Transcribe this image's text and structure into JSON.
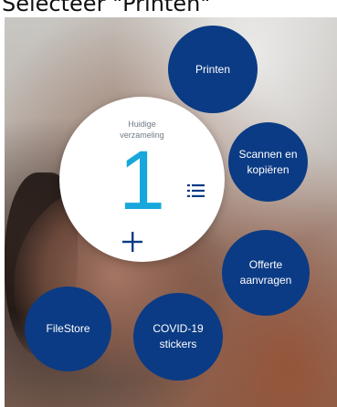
{
  "header": {
    "text": "Selecteer \"Printen\""
  },
  "collection": {
    "label": "Huidige\nverzameling",
    "count": "1"
  },
  "bubbles": {
    "printen": "Printen",
    "scannen": "Scannen en\nkopiëren",
    "offerte": "Offerte\naanvragen",
    "covid": "COVID-19\nstickers",
    "filestore": "FileStore"
  },
  "icons": {
    "list": "list-icon",
    "add": "plus-icon"
  },
  "colors": {
    "bubble": "#0b3b84",
    "count": "#18a7dc",
    "text_white": "#ffffff"
  }
}
